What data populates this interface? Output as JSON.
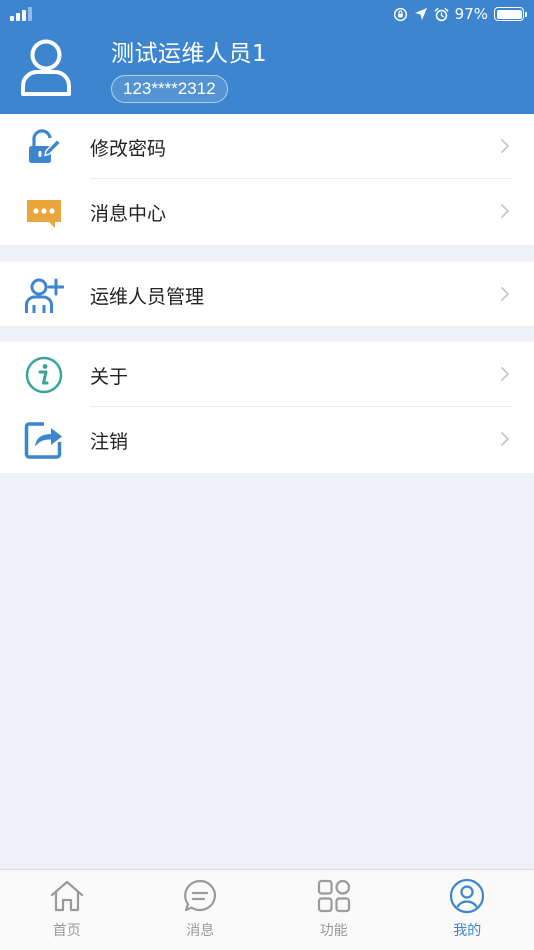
{
  "status_bar": {
    "battery": "97%"
  },
  "user": {
    "name": "测试运维人员1",
    "phone": "123****2312"
  },
  "menu": {
    "group1": [
      {
        "label": "修改密码",
        "icon": "lock-edit-icon"
      },
      {
        "label": "消息中心",
        "icon": "message-icon"
      }
    ],
    "group2": [
      {
        "label": "运维人员管理",
        "icon": "add-user-icon"
      }
    ],
    "group3": [
      {
        "label": "关于",
        "icon": "info-icon"
      },
      {
        "label": "注销",
        "icon": "logout-share-icon"
      }
    ]
  },
  "tabs": [
    {
      "label": "首页",
      "icon": "home-icon"
    },
    {
      "label": "消息",
      "icon": "chat-icon"
    },
    {
      "label": "功能",
      "icon": "grid-icon"
    },
    {
      "label": "我的",
      "icon": "profile-icon",
      "active": true
    }
  ],
  "colors": {
    "brand": "#3d86cf",
    "accent_orange": "#eaa53c",
    "teal": "#3aa39a",
    "tab_inactive": "#999999"
  }
}
